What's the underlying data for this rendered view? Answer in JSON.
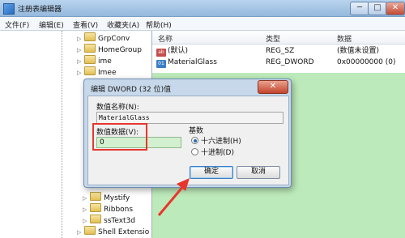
{
  "window": {
    "title": "注册表编辑器",
    "minimize": "─",
    "maximize": "□",
    "close": "✕"
  },
  "menu": {
    "file": "文件(F)",
    "edit": "编辑(E)",
    "view": "查看(V)",
    "favorites": "收藏夹(A)",
    "help": "帮助(H)"
  },
  "tree": {
    "items": [
      {
        "label": "GrpConv",
        "expandable": true
      },
      {
        "label": "HomeGroup",
        "expandable": true
      },
      {
        "label": "ime",
        "expandable": true
      },
      {
        "label": "Imee",
        "expandable": true
      },
      {
        "label": "Mystify",
        "expandable": true
      },
      {
        "label": "Ribbons",
        "expandable": true
      },
      {
        "label": "ssText3d",
        "expandable": true
      },
      {
        "label": "Shell Extensio",
        "expandable": true
      }
    ]
  },
  "list": {
    "headers": {
      "name": "名称",
      "type": "类型",
      "data": "数据"
    },
    "rows": [
      {
        "name": "(默认)",
        "type": "REG_SZ",
        "data": "(数值未设置)",
        "icon": "string-value-icon"
      },
      {
        "name": "MaterialGlass",
        "type": "REG_DWORD",
        "data": "0x00000000 (0)",
        "icon": "binary-value-icon"
      }
    ]
  },
  "dialog": {
    "title": "编辑 DWORD (32 位)值",
    "close": "✕",
    "name_label": "数值名称(N):",
    "name_value": "MaterialGlass",
    "data_label": "数值数据(V):",
    "data_value": "0",
    "base_label": "基数",
    "radio_hex": "十六进制(H)",
    "radio_dec": "十进制(D)",
    "hex_selected": true,
    "ok": "确定",
    "cancel": "取消"
  },
  "colors": {
    "highlight_green": "#a7e3a3",
    "annotation_red": "#e8362d"
  }
}
